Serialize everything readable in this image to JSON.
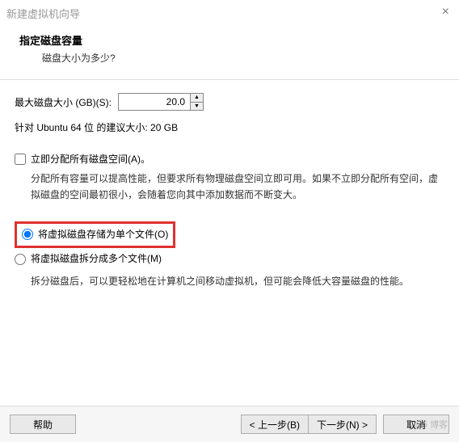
{
  "window": {
    "title": "新建虚拟机向导",
    "close_icon": "×"
  },
  "header": {
    "title": "指定磁盘容量",
    "subtitle": "磁盘大小为多少?"
  },
  "disk": {
    "label": "最大磁盘大小 (GB)(S):",
    "value": "20.0",
    "recommend": "针对 Ubuntu 64 位 的建议大小: 20 GB"
  },
  "allocate": {
    "label": "立即分配所有磁盘空间(A)。",
    "desc": "分配所有容量可以提高性能，但要求所有物理磁盘空间立即可用。如果不立即分配所有空间，虚拟磁盘的空间最初很小，会随着您向其中添加数据而不断变大。"
  },
  "store": {
    "single_label": "将虚拟磁盘存储为单个文件(O)",
    "split_label": "将虚拟磁盘拆分成多个文件(M)",
    "split_desc": "拆分磁盘后，可以更轻松地在计算机之间移动虚拟机，但可能会降低大容量磁盘的性能。"
  },
  "footer": {
    "help": "帮助",
    "back": "< 上一步(B)",
    "next": "下一步(N) >",
    "cancel": "取消"
  },
  "watermark": "@5 博客"
}
